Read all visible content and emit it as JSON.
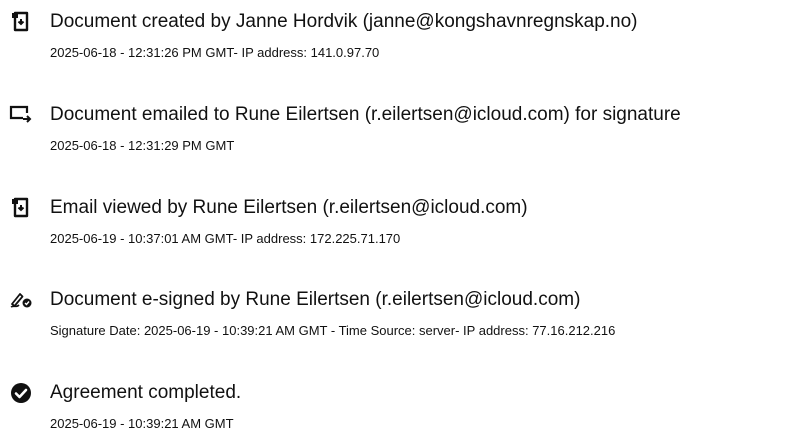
{
  "events": [
    {
      "icon": "document-created-icon",
      "title": "Document created by Janne Hordvik (janne@kongshavnregnskap.no)",
      "detail": "2025-06-18 - 12:31:26 PM GMT- IP address: 141.0.97.70"
    },
    {
      "icon": "email-sent-icon",
      "title": "Document emailed to Rune Eilertsen (r.eilertsen@icloud.com) for signature",
      "detail": "2025-06-18 - 12:31:29 PM GMT"
    },
    {
      "icon": "email-viewed-icon",
      "title": "Email viewed by Rune Eilertsen (r.eilertsen@icloud.com)",
      "detail": "2025-06-19 - 10:37:01 AM GMT- IP address: 172.225.71.170"
    },
    {
      "icon": "e-sign-pen-icon",
      "title": "Document e-signed by Rune Eilertsen (r.eilertsen@icloud.com)",
      "detail": "Signature Date: 2025-06-19 - 10:39:21 AM GMT - Time Source: server- IP address: 77.16.212.216"
    },
    {
      "icon": "checkmark-circle-icon",
      "title": "Agreement completed.",
      "detail": "2025-06-19 - 10:39:21 AM GMT"
    }
  ]
}
